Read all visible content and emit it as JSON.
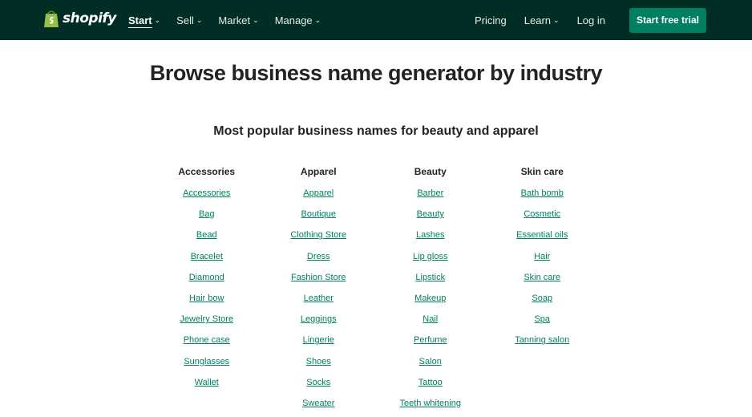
{
  "nav": {
    "brand": "shopify",
    "menu": [
      {
        "label": "Start"
      },
      {
        "label": "Sell"
      },
      {
        "label": "Market"
      },
      {
        "label": "Manage"
      }
    ],
    "pricing": "Pricing",
    "learn": "Learn",
    "login": "Log in",
    "cta": "Start free trial"
  },
  "title": "Browse business name generator by industry",
  "subtitle": "Most popular business names for beauty and apparel",
  "columns": [
    {
      "heading": "Accessories",
      "links": [
        "Accessories",
        "Bag",
        "Bead",
        "Bracelet",
        "Diamond",
        "Hair bow",
        "Jewelry Store",
        "Phone case",
        "Sunglasses",
        "Wallet"
      ]
    },
    {
      "heading": "Apparel",
      "links": [
        "Apparel",
        "Boutique",
        "Clothing Store",
        "Dress",
        "Fashion Store",
        "Leather",
        "Leggings",
        "Lingerie",
        "Shoes",
        "Socks",
        "Sweater"
      ]
    },
    {
      "heading": "Beauty",
      "links": [
        "Barber",
        "Beauty",
        "Lashes",
        "Lip gloss",
        "Lipstick",
        "Makeup",
        "Nail",
        "Perfume",
        "Salon",
        "Tattoo",
        "Teeth whitening"
      ]
    },
    {
      "heading": "Skin care",
      "links": [
        "Bath bomb",
        "Cosmetic",
        "Essential oils",
        "Hair",
        "Skin care",
        "Soap",
        "Spa",
        "Tanning salon"
      ]
    }
  ]
}
